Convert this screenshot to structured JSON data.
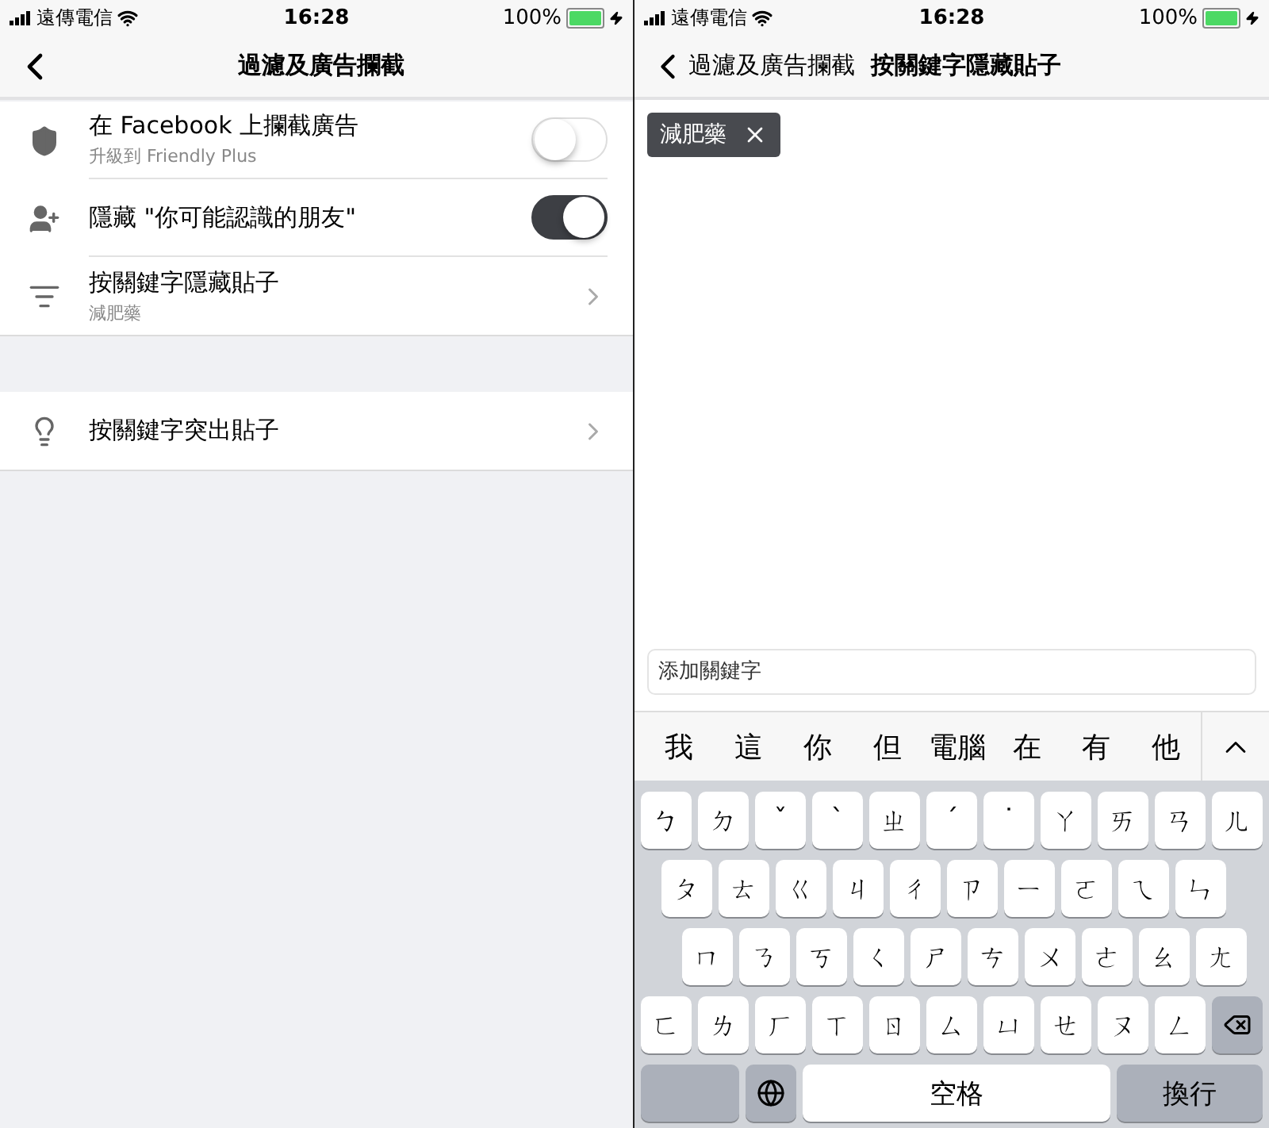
{
  "left": {
    "status_bar": {
      "carrier": "遠傳電信",
      "time": "16:28",
      "battery": "100%"
    },
    "nav": {
      "title": "過濾及廣告攔截"
    },
    "sections": [
      {
        "rows": [
          {
            "kind": "toggle",
            "label": "在 Facebook 上攔截廣告",
            "sublabel": "升級到 Friendly Plus",
            "on": false
          },
          {
            "kind": "toggle",
            "label": "隱藏 \"你可能認識的朋友\"",
            "on": true
          },
          {
            "kind": "link",
            "label": "按關鍵字隱藏貼子",
            "sublabel": "減肥藥"
          }
        ]
      },
      {
        "rows": [
          {
            "kind": "link",
            "label": "按關鍵字突出貼子"
          }
        ]
      }
    ]
  },
  "right": {
    "status_bar": {
      "carrier": "遠傳電信",
      "time": "16:28",
      "battery": "100%"
    },
    "nav": {
      "back": "過濾及廣告攔截",
      "title": "按關鍵字隱藏貼子"
    },
    "keywords": [
      "減肥藥"
    ],
    "input": {
      "placeholder": "添加關鍵字"
    },
    "candidates": [
      "我",
      "這",
      "你",
      "但",
      "電腦",
      "在",
      "有",
      "他"
    ],
    "keyboard": {
      "rows": [
        [
          "ㄅ",
          "ㄉ",
          "ˇ",
          "ˋ",
          "ㄓ",
          "ˊ",
          "˙",
          "ㄚ",
          "ㄞ",
          "ㄢ",
          "ㄦ"
        ],
        [
          "ㄆ",
          "ㄊ",
          "ㄍ",
          "ㄐ",
          "ㄔ",
          "ㄗ",
          "ㄧ",
          "ㄛ",
          "ㄟ",
          "ㄣ"
        ],
        [
          "ㄇ",
          "ㄋ",
          "ㄎ",
          "ㄑ",
          "ㄕ",
          "ㄘ",
          "ㄨ",
          "ㄜ",
          "ㄠ",
          "ㄤ"
        ],
        [
          "ㄈ",
          "ㄌ",
          "ㄏ",
          "ㄒ",
          "ㄖ",
          "ㄙ",
          "ㄩ",
          "ㄝ",
          "ㄡ",
          "ㄥ"
        ]
      ],
      "space": "空格",
      "return": "換行"
    }
  }
}
